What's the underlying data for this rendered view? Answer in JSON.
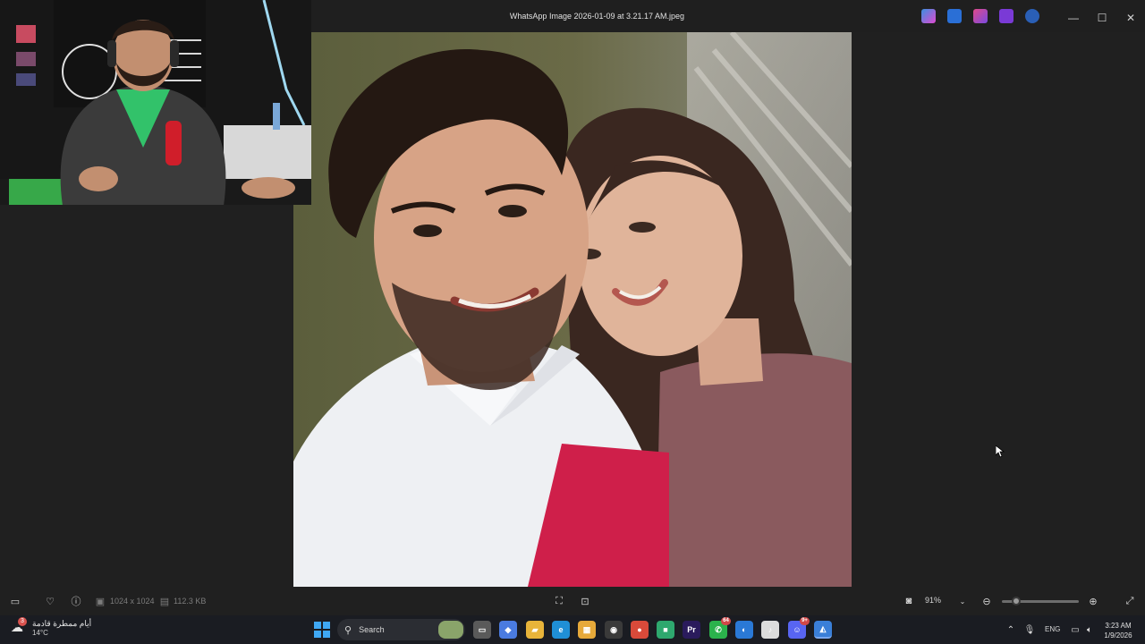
{
  "window": {
    "title": "WhatsApp Image 2026-01-09 at 3.21.17 AM.jpeg",
    "minimize_glyph": "—",
    "maximize_glyph": "☐",
    "close_glyph": "✕"
  },
  "app_toolbar": {
    "icons": [
      "copilot-icon",
      "edit-image-icon",
      "designer-icon",
      "clipchamp-icon",
      "onedrive-icon"
    ]
  },
  "bottom_bar": {
    "dimensions": "1024 x 1024",
    "file_size": "112.3 KB",
    "zoom": "91%",
    "zoom_level": 0.15
  },
  "taskbar": {
    "weather": {
      "badge": "3",
      "text": "أيام ممطرة قادمة",
      "temp": "14°C"
    },
    "search_placeholder": "Search",
    "apps": [
      {
        "name": "file-explorer-alt",
        "glyph": "▭",
        "color": "#5a5a5a"
      },
      {
        "name": "copilot",
        "glyph": "◆",
        "color": "#4a7be0"
      },
      {
        "name": "file-explorer",
        "glyph": "▰",
        "color": "#e8b43a"
      },
      {
        "name": "edge",
        "glyph": "e",
        "color": "#1f8fd6"
      },
      {
        "name": "store",
        "glyph": "▦",
        "color": "#e6a93a"
      },
      {
        "name": "alien-app",
        "glyph": "◉",
        "color": "#3a3a3a"
      },
      {
        "name": "chrome",
        "glyph": "●",
        "color": "#d94a3a"
      },
      {
        "name": "app-green",
        "glyph": "■",
        "color": "#2ea86e"
      },
      {
        "name": "premiere",
        "glyph": "Pr",
        "color": "#2a1b5c"
      },
      {
        "name": "whatsapp",
        "glyph": "✆",
        "color": "#2bb24c",
        "count": "64"
      },
      {
        "name": "app-blue-globe",
        "glyph": "◐",
        "color": "#2a79d6"
      },
      {
        "name": "itunes",
        "glyph": "♪",
        "color": "#dcdcdc"
      },
      {
        "name": "discord",
        "glyph": "☺",
        "color": "#5865f2",
        "count": "9+"
      },
      {
        "name": "photos",
        "glyph": "◭",
        "color": "#3a7fd8"
      }
    ],
    "language": "ENG",
    "time": "3:23 AM",
    "date": "1/9/2026"
  }
}
